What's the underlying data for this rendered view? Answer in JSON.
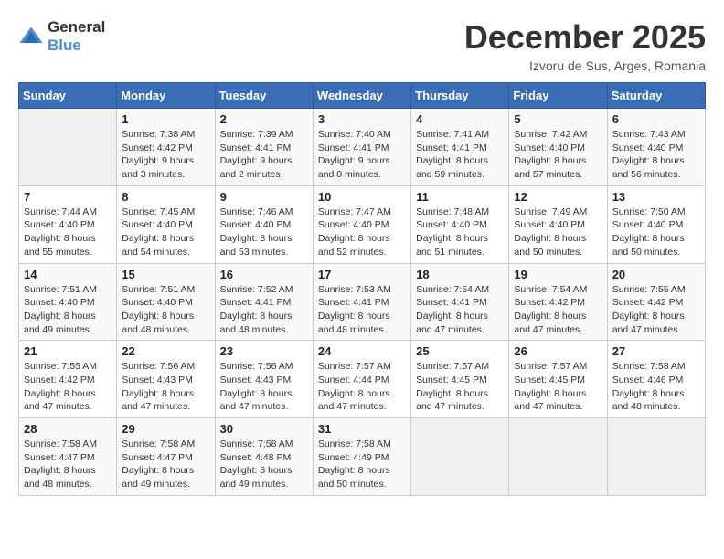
{
  "header": {
    "logo_line1": "General",
    "logo_line2": "Blue",
    "month": "December 2025",
    "location": "Izvoru de Sus, Arges, Romania"
  },
  "days_of_week": [
    "Sunday",
    "Monday",
    "Tuesday",
    "Wednesday",
    "Thursday",
    "Friday",
    "Saturday"
  ],
  "weeks": [
    [
      {
        "day": "",
        "info": ""
      },
      {
        "day": "1",
        "info": "Sunrise: 7:38 AM\nSunset: 4:42 PM\nDaylight: 9 hours\nand 3 minutes."
      },
      {
        "day": "2",
        "info": "Sunrise: 7:39 AM\nSunset: 4:41 PM\nDaylight: 9 hours\nand 2 minutes."
      },
      {
        "day": "3",
        "info": "Sunrise: 7:40 AM\nSunset: 4:41 PM\nDaylight: 9 hours\nand 0 minutes."
      },
      {
        "day": "4",
        "info": "Sunrise: 7:41 AM\nSunset: 4:41 PM\nDaylight: 8 hours\nand 59 minutes."
      },
      {
        "day": "5",
        "info": "Sunrise: 7:42 AM\nSunset: 4:40 PM\nDaylight: 8 hours\nand 57 minutes."
      },
      {
        "day": "6",
        "info": "Sunrise: 7:43 AM\nSunset: 4:40 PM\nDaylight: 8 hours\nand 56 minutes."
      }
    ],
    [
      {
        "day": "7",
        "info": "Sunrise: 7:44 AM\nSunset: 4:40 PM\nDaylight: 8 hours\nand 55 minutes."
      },
      {
        "day": "8",
        "info": "Sunrise: 7:45 AM\nSunset: 4:40 PM\nDaylight: 8 hours\nand 54 minutes."
      },
      {
        "day": "9",
        "info": "Sunrise: 7:46 AM\nSunset: 4:40 PM\nDaylight: 8 hours\nand 53 minutes."
      },
      {
        "day": "10",
        "info": "Sunrise: 7:47 AM\nSunset: 4:40 PM\nDaylight: 8 hours\nand 52 minutes."
      },
      {
        "day": "11",
        "info": "Sunrise: 7:48 AM\nSunset: 4:40 PM\nDaylight: 8 hours\nand 51 minutes."
      },
      {
        "day": "12",
        "info": "Sunrise: 7:49 AM\nSunset: 4:40 PM\nDaylight: 8 hours\nand 50 minutes."
      },
      {
        "day": "13",
        "info": "Sunrise: 7:50 AM\nSunset: 4:40 PM\nDaylight: 8 hours\nand 50 minutes."
      }
    ],
    [
      {
        "day": "14",
        "info": "Sunrise: 7:51 AM\nSunset: 4:40 PM\nDaylight: 8 hours\nand 49 minutes."
      },
      {
        "day": "15",
        "info": "Sunrise: 7:51 AM\nSunset: 4:40 PM\nDaylight: 8 hours\nand 48 minutes."
      },
      {
        "day": "16",
        "info": "Sunrise: 7:52 AM\nSunset: 4:41 PM\nDaylight: 8 hours\nand 48 minutes."
      },
      {
        "day": "17",
        "info": "Sunrise: 7:53 AM\nSunset: 4:41 PM\nDaylight: 8 hours\nand 48 minutes."
      },
      {
        "day": "18",
        "info": "Sunrise: 7:54 AM\nSunset: 4:41 PM\nDaylight: 8 hours\nand 47 minutes."
      },
      {
        "day": "19",
        "info": "Sunrise: 7:54 AM\nSunset: 4:42 PM\nDaylight: 8 hours\nand 47 minutes."
      },
      {
        "day": "20",
        "info": "Sunrise: 7:55 AM\nSunset: 4:42 PM\nDaylight: 8 hours\nand 47 minutes."
      }
    ],
    [
      {
        "day": "21",
        "info": "Sunrise: 7:55 AM\nSunset: 4:42 PM\nDaylight: 8 hours\nand 47 minutes."
      },
      {
        "day": "22",
        "info": "Sunrise: 7:56 AM\nSunset: 4:43 PM\nDaylight: 8 hours\nand 47 minutes."
      },
      {
        "day": "23",
        "info": "Sunrise: 7:56 AM\nSunset: 4:43 PM\nDaylight: 8 hours\nand 47 minutes."
      },
      {
        "day": "24",
        "info": "Sunrise: 7:57 AM\nSunset: 4:44 PM\nDaylight: 8 hours\nand 47 minutes."
      },
      {
        "day": "25",
        "info": "Sunrise: 7:57 AM\nSunset: 4:45 PM\nDaylight: 8 hours\nand 47 minutes."
      },
      {
        "day": "26",
        "info": "Sunrise: 7:57 AM\nSunset: 4:45 PM\nDaylight: 8 hours\nand 47 minutes."
      },
      {
        "day": "27",
        "info": "Sunrise: 7:58 AM\nSunset: 4:46 PM\nDaylight: 8 hours\nand 48 minutes."
      }
    ],
    [
      {
        "day": "28",
        "info": "Sunrise: 7:58 AM\nSunset: 4:47 PM\nDaylight: 8 hours\nand 48 minutes."
      },
      {
        "day": "29",
        "info": "Sunrise: 7:58 AM\nSunset: 4:47 PM\nDaylight: 8 hours\nand 49 minutes."
      },
      {
        "day": "30",
        "info": "Sunrise: 7:58 AM\nSunset: 4:48 PM\nDaylight: 8 hours\nand 49 minutes."
      },
      {
        "day": "31",
        "info": "Sunrise: 7:58 AM\nSunset: 4:49 PM\nDaylight: 8 hours\nand 50 minutes."
      },
      {
        "day": "",
        "info": ""
      },
      {
        "day": "",
        "info": ""
      },
      {
        "day": "",
        "info": ""
      }
    ]
  ]
}
